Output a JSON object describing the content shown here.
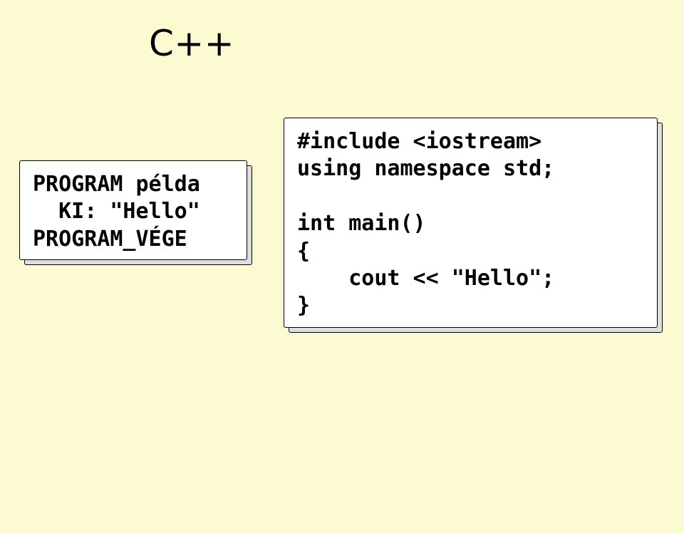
{
  "title": "C++",
  "pseudocode": "PROGRAM példa\n  KI: \"Hello\"\nPROGRAM_VÉGE",
  "cpp_code": "#include <iostream>\nusing namespace std;\n\nint main()\n{\n    cout << \"Hello\";\n}"
}
